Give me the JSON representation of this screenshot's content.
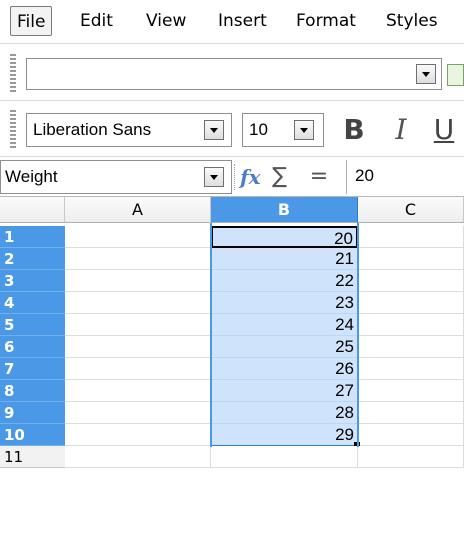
{
  "menu": {
    "items": [
      {
        "label": "File",
        "active": true
      },
      {
        "label": "Edit"
      },
      {
        "label": "View"
      },
      {
        "label": "Insert"
      },
      {
        "label": "Format"
      },
      {
        "label": "Styles"
      }
    ]
  },
  "toolbar": {
    "font_name": "Liberation Sans",
    "font_size": "10",
    "bold_label": "B",
    "italic_label": "I",
    "underline_label": "U"
  },
  "formula_bar": {
    "name_box": "Weight",
    "fx_label": "fx",
    "sum_label": "∑",
    "equals_label": "=",
    "content": "20"
  },
  "sheet": {
    "columns": [
      "A",
      "B",
      "C"
    ],
    "selected_column": "B",
    "rows": [
      {
        "num": "1",
        "b": "20"
      },
      {
        "num": "2",
        "b": "21"
      },
      {
        "num": "3",
        "b": "22"
      },
      {
        "num": "4",
        "b": "23"
      },
      {
        "num": "5",
        "b": "24"
      },
      {
        "num": "6",
        "b": "25"
      },
      {
        "num": "7",
        "b": "26"
      },
      {
        "num": "8",
        "b": "27"
      },
      {
        "num": "9",
        "b": "28"
      },
      {
        "num": "10",
        "b": "29"
      }
    ],
    "next_row": "11"
  },
  "colors": {
    "selection_header": "#4a98e6",
    "selection_fill": "#cfe4fb"
  }
}
